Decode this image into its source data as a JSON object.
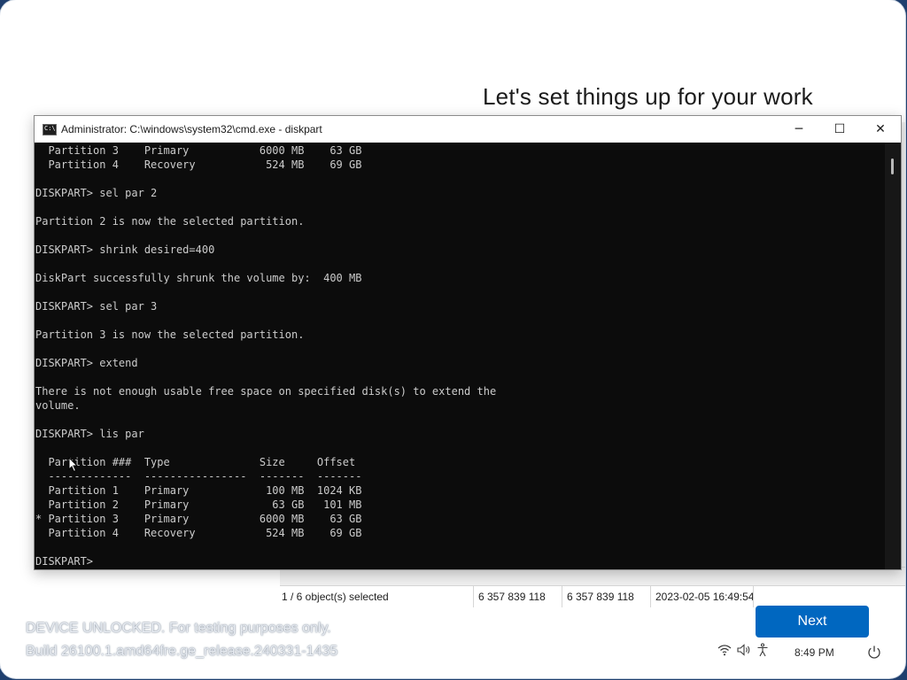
{
  "oobe": {
    "title": "Let's set things up for your work",
    "next_label": "Next",
    "watermark_line1": "DEVICE UNLOCKED. For testing purposes only.",
    "watermark_line2": "Build 26100.1.amd64fre.ge_release.240331-1435"
  },
  "explorer_status": {
    "selection": "1 / 6 object(s) selected",
    "size1": "6 357 839 118",
    "size2": "6 357 839 118",
    "date": "2023-02-05 16:49:54"
  },
  "cmd": {
    "title": "Administrator: C:\\windows\\system32\\cmd.exe - diskpart",
    "icon_label": "C:\\",
    "minimize_label": "─",
    "maximize_label": "☐",
    "close_label": "✕",
    "console_lines": [
      "  Partition 3    Primary           6000 MB    63 GB",
      "  Partition 4    Recovery           524 MB    69 GB",
      "",
      "DISKPART> sel par 2",
      "",
      "Partition 2 is now the selected partition.",
      "",
      "DISKPART> shrink desired=400",
      "",
      "DiskPart successfully shrunk the volume by:  400 MB",
      "",
      "DISKPART> sel par 3",
      "",
      "Partition 3 is now the selected partition.",
      "",
      "DISKPART> extend",
      "",
      "There is not enough usable free space on specified disk(s) to extend the",
      "volume.",
      "",
      "DISKPART> lis par",
      "",
      "  Partition ###  Type              Size     Offset",
      "  -------------  ----------------  -------  -------",
      "  Partition 1    Primary            100 MB  1024 KB",
      "  Partition 2    Primary             63 GB   101 MB",
      "* Partition 3    Primary           6000 MB    63 GB",
      "  Partition 4    Recovery           524 MB    69 GB",
      "",
      "DISKPART>"
    ]
  },
  "tray": {
    "wifi_icon": "wifi-icon",
    "volume_icon": "volume-icon",
    "accessibility_icon": "accessibility-icon",
    "power_icon": "power-icon",
    "time": "8:49 PM"
  },
  "colors": {
    "accent": "#0067c0",
    "console_bg": "#0c0c0c",
    "console_fg": "#cccccc"
  }
}
